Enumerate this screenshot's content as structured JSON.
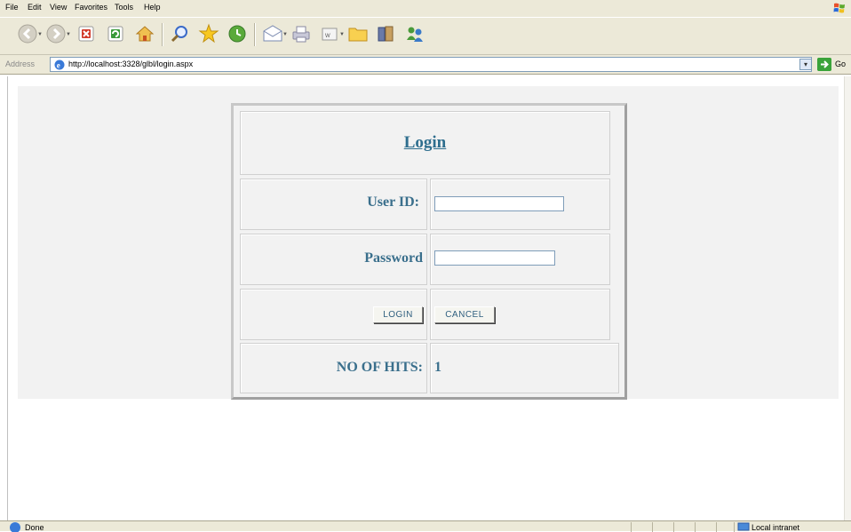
{
  "menu": [
    "File",
    "Edit",
    "View",
    "Favorites",
    "Tools",
    "Help"
  ],
  "address": {
    "label": "Address",
    "url": "http://localhost:3328/glbl/login.aspx",
    "go_label": "Go"
  },
  "login": {
    "title": "Login",
    "user_label": "User ID:",
    "password_label": "Password",
    "user_value": "",
    "password_value": "",
    "login_button": "LOGIN",
    "cancel_button": "CANCEL",
    "hits_label": "NO OF HITS:",
    "hits_value": "1"
  },
  "status": {
    "text": "Done",
    "zone": "Local intranet"
  },
  "toolbar_icons": [
    "back-icon",
    "forward-icon",
    "stop-icon",
    "refresh-icon",
    "home-icon",
    "search-icon",
    "favorites-icon",
    "history-icon",
    "mail-icon",
    "print-icon",
    "edit-icon",
    "folder-icon",
    "research-icon",
    "messenger-icon"
  ],
  "colors": {
    "accent": "#2e6e8e",
    "chrome": "#ece9d8"
  }
}
